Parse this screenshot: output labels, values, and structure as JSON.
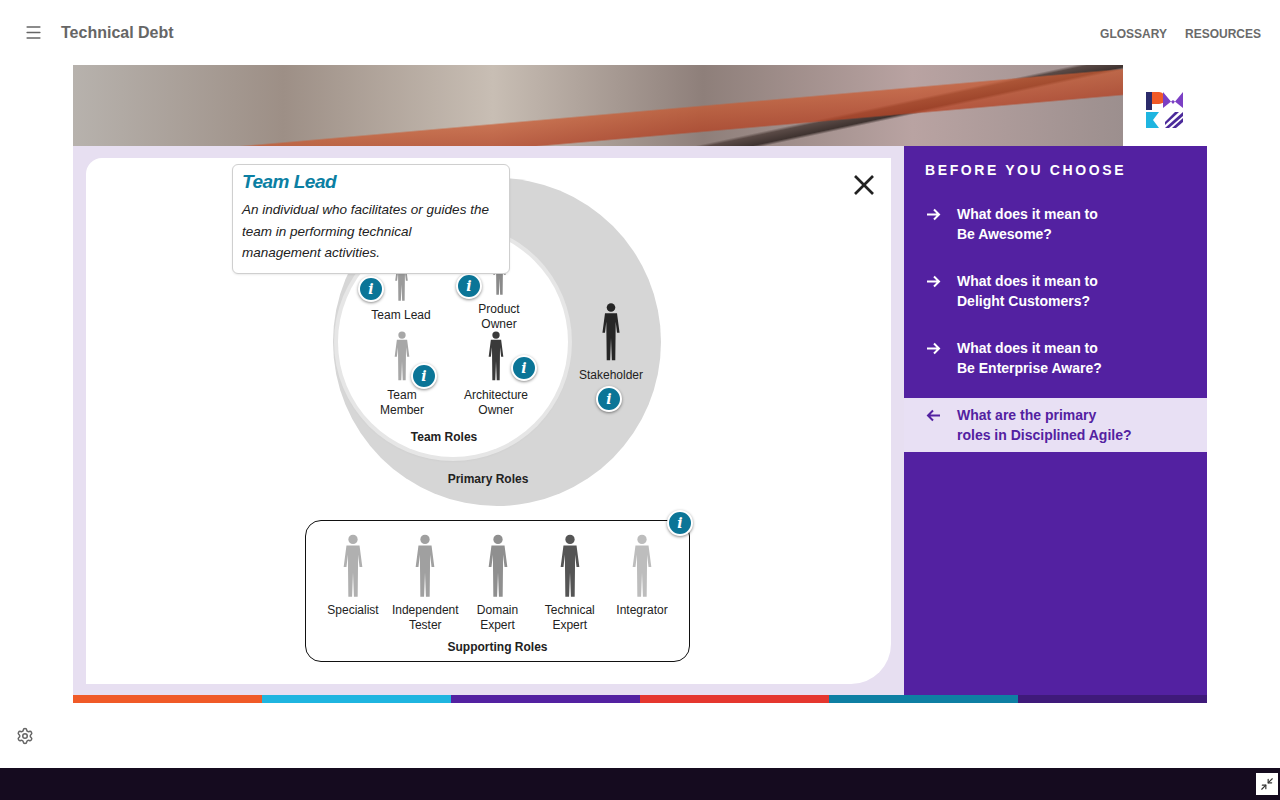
{
  "header": {
    "title": "Technical Debt",
    "links": [
      "GLOSSARY",
      "RESOURCES"
    ]
  },
  "tooltip": {
    "title": "Team Lead",
    "lines": [
      "An individual who facilitates or guides the",
      "team in performing technical",
      "management activities."
    ]
  },
  "diagram": {
    "info_glyph": "i",
    "team_roles_label": "Team Roles",
    "primary_roles_label": "Primary Roles",
    "supporting_roles_label": "Supporting Roles",
    "primary_roles": [
      {
        "lines": [
          "Team Lead"
        ]
      },
      {
        "lines": [
          "Product",
          "Owner"
        ]
      },
      {
        "lines": [
          "Team",
          "Member"
        ]
      },
      {
        "lines": [
          "Architecture",
          "Owner"
        ]
      },
      {
        "lines": [
          "Stakeholder"
        ]
      }
    ],
    "supporting_roles": [
      {
        "lines": [
          "Specialist"
        ]
      },
      {
        "lines": [
          "Independent",
          "Tester"
        ]
      },
      {
        "lines": [
          "Domain",
          "Expert"
        ]
      },
      {
        "lines": [
          "Technical",
          "Expert"
        ]
      },
      {
        "lines": [
          "Integrator"
        ]
      }
    ]
  },
  "sidebar": {
    "heading": "BEFORE YOU CHOOSE",
    "items": [
      {
        "lines": [
          "What does it mean to",
          "Be Awesome?"
        ],
        "selected": false
      },
      {
        "lines": [
          "What does it mean to",
          "Delight Customers?"
        ],
        "selected": false
      },
      {
        "lines": [
          "What does it mean to",
          "Be Enterprise Aware?"
        ],
        "selected": false
      },
      {
        "lines": [
          "What are the primary",
          "roles in Disciplined Agile?"
        ],
        "selected": true
      }
    ]
  }
}
